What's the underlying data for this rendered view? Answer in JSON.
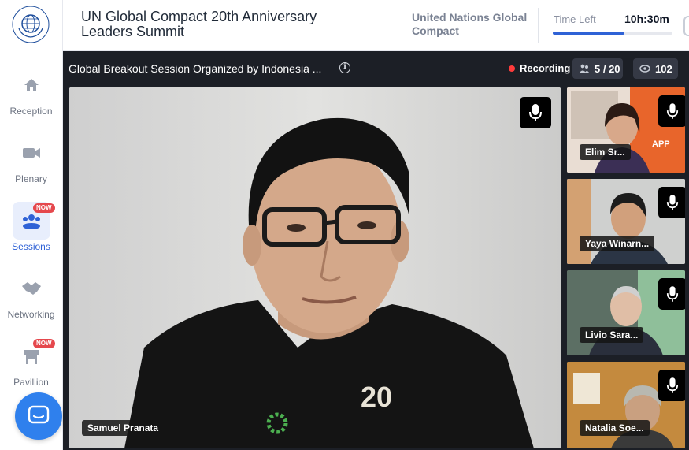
{
  "app": {
    "event_title": "UN Global Compact 20th Anniversary Leaders Summit",
    "organization": "United Nations Global Compact",
    "time_label": "Time Left",
    "time_value": "10h:30m",
    "time_progress": 0.6
  },
  "sidebar": {
    "items": [
      {
        "label": "Reception",
        "icon": "home-icon",
        "active": false
      },
      {
        "label": "Plenary",
        "icon": "video-camera-icon",
        "active": false
      },
      {
        "label": "Sessions",
        "icon": "group-icon",
        "active": true,
        "badge": "NOW"
      },
      {
        "label": "Networking",
        "icon": "handshake-icon",
        "active": false
      },
      {
        "label": "Pavillion",
        "icon": "booth-icon",
        "active": false,
        "badge": "NOW"
      }
    ]
  },
  "session": {
    "title": "Global Breakout Session Organized by Indonesia ...",
    "recording_label": "Recording",
    "participants": "5 / 20",
    "viewers": "102",
    "main_speaker": "Samuel Pranata",
    "thumbnails": [
      {
        "name": "Elim Sr..."
      },
      {
        "name": "Yaya Winarn..."
      },
      {
        "name": "Livio Sara..."
      },
      {
        "name": "Natalia Soe..."
      }
    ]
  },
  "colors": {
    "accent": "#2f62d6",
    "recording": "#ff3b3b",
    "badge": "#e5484d",
    "stage_bg": "#1c1f26"
  }
}
